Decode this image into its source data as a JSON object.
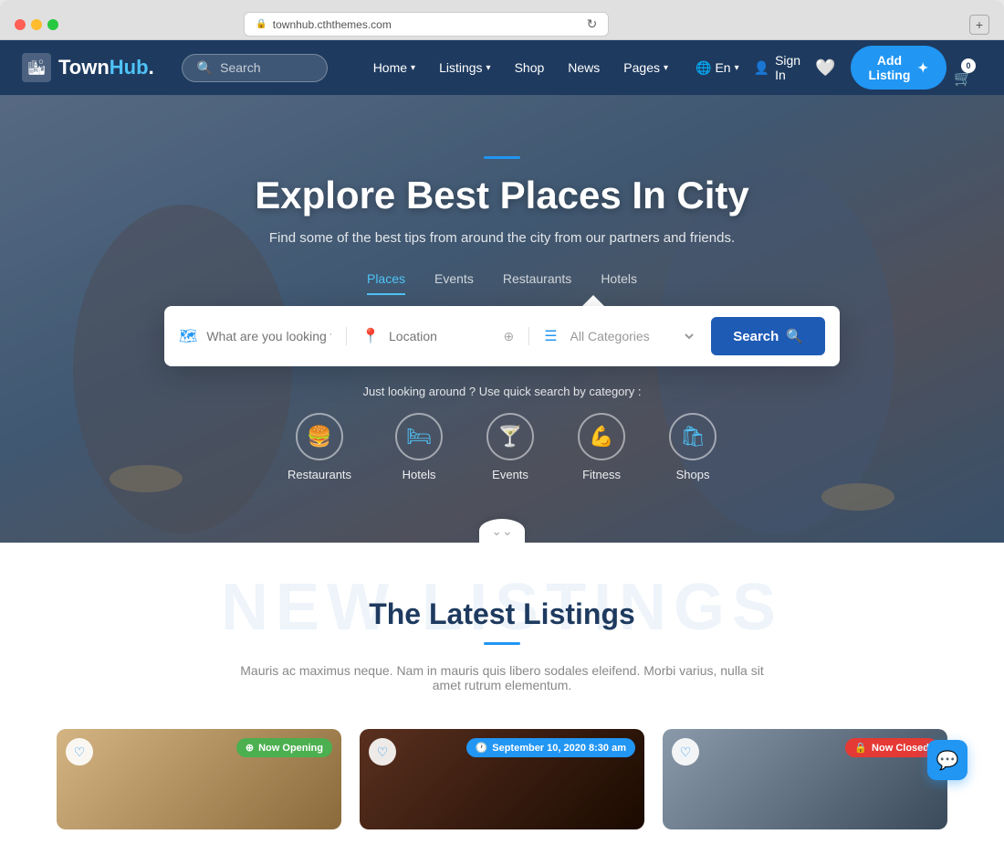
{
  "browser": {
    "address": "townhub.cththemes.com",
    "lock_icon": "🔒"
  },
  "navbar": {
    "logo_text": "TownHub",
    "logo_highlight": "Hub",
    "search_placeholder": "Search",
    "nav_links": [
      {
        "label": "Home",
        "has_dropdown": true
      },
      {
        "label": "Listings",
        "has_dropdown": true
      },
      {
        "label": "Shop",
        "has_dropdown": false
      },
      {
        "label": "News",
        "has_dropdown": false
      },
      {
        "label": "Pages",
        "has_dropdown": true
      }
    ],
    "lang": "En",
    "sign_in": "Sign In",
    "add_listing": "Add Listing"
  },
  "hero": {
    "accent_line": true,
    "title": "Explore Best Places In City",
    "subtitle": "Find some of the best tips from around the city from our partners and friends.",
    "tabs": [
      {
        "label": "Places",
        "active": true
      },
      {
        "label": "Events",
        "active": false
      },
      {
        "label": "Restaurants",
        "active": false
      },
      {
        "label": "Hotels",
        "active": false
      }
    ],
    "search": {
      "what_placeholder": "What are you looking for?",
      "location_placeholder": "Location",
      "categories_label": "All Categories",
      "search_btn": "Search"
    },
    "quick_search_label": "Just looking around ? Use quick search by category :",
    "categories": [
      {
        "label": "Restaurants",
        "icon": "🍔"
      },
      {
        "label": "Hotels",
        "icon": "🛏"
      },
      {
        "label": "Events",
        "icon": "🍸"
      },
      {
        "label": "Fitness",
        "icon": "💪"
      },
      {
        "label": "Shops",
        "icon": "🛍"
      }
    ]
  },
  "listings_section": {
    "bg_text": "NEW LISTINGS",
    "title": "The Latest Listings",
    "description": "Mauris ac maximus neque. Nam in mauris quis libero sodales eleifend. Morbi varius, nulla sit amet rutrum elementum.",
    "cards": [
      {
        "badge_label": "Now Opening",
        "badge_type": "green",
        "badge_position": "right",
        "heart": true
      },
      {
        "badge_label": "September 10, 2020 8:30 am",
        "badge_type": "blue",
        "badge_position": "right",
        "heart": true
      },
      {
        "badge_label": "Now Closed",
        "badge_type": "red",
        "badge_position": "right",
        "heart": true
      }
    ]
  },
  "chat_btn": "💬"
}
